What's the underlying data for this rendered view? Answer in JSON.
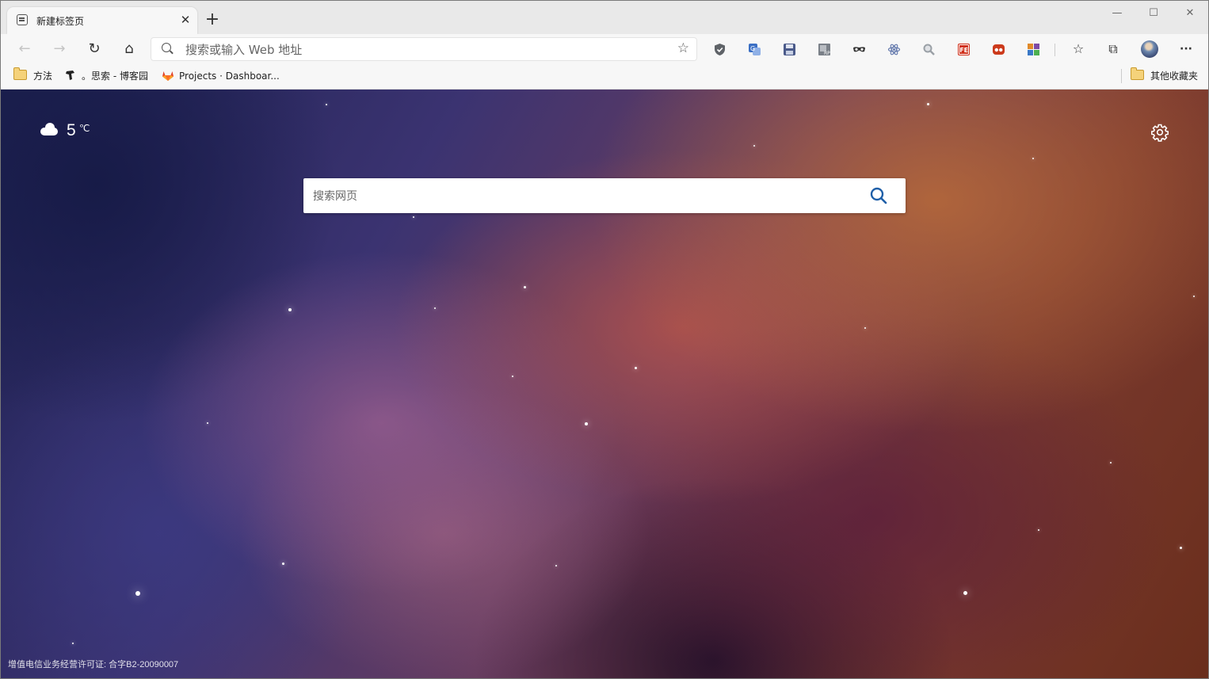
{
  "window": {
    "minimize_glyph": "—",
    "maximize_glyph": "☐",
    "close_glyph": "✕"
  },
  "tab": {
    "title": "新建标签页",
    "icon": "new-tab-page-icon",
    "close_glyph": "✕"
  },
  "new_tab_glyph": "+",
  "nav": {
    "back_glyph": "←",
    "forward_glyph": "→",
    "refresh_glyph": "↻",
    "home_glyph": "⌂"
  },
  "address_bar": {
    "placeholder": "搜索或输入 Web 地址",
    "value": "",
    "favorite_glyph": "☆"
  },
  "extensions": [
    {
      "name": "shield-extension-icon",
      "color": "#5f6368"
    },
    {
      "name": "translate-extension-icon",
      "color": "#3b6fc4"
    },
    {
      "name": "save-extension-icon",
      "color": "#4a5a8a"
    },
    {
      "name": "rp-extension-icon",
      "color": "#7a8088"
    },
    {
      "name": "mask-extension-icon",
      "color": "#333333"
    },
    {
      "name": "react-extension-icon",
      "color": "#6a7fb0"
    },
    {
      "name": "search-extension-icon",
      "color": "#9aa0a6"
    },
    {
      "name": "fe-extension-icon",
      "color": "#d0311b"
    },
    {
      "name": "dots-extension-icon",
      "color": "#cc3a1b"
    },
    {
      "name": "color-extension-icon",
      "color": "#e08a2b"
    }
  ],
  "toolbar": {
    "favorites_glyph": "☆",
    "collections_glyph": "⧉",
    "more_glyph": "···"
  },
  "bookmarks": {
    "items": [
      {
        "label": "方法",
        "icon": "folder-icon"
      },
      {
        "label": "。思索 - 博客园",
        "icon": "cnblogs-icon"
      },
      {
        "label": "Projects · Dashboar...",
        "icon": "gitlab-icon"
      }
    ],
    "other_label": "其他收藏夹"
  },
  "page": {
    "weather": {
      "icon": "cloud-icon",
      "temperature": "5",
      "unit": "℃"
    },
    "search": {
      "placeholder": "搜索网页",
      "value": ""
    },
    "footer": "增值电信业务经营许可证: 合字B2-20090007"
  }
}
